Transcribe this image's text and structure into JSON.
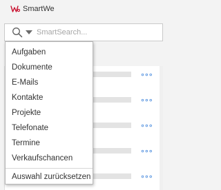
{
  "app": {
    "title": "SmartWe",
    "logo_text": "We",
    "brand_color": "#c8102e"
  },
  "search": {
    "placeholder": "SmartSearch...",
    "value": ""
  },
  "menu": {
    "items": [
      {
        "label": "Aufgaben"
      },
      {
        "label": "Dokumente"
      },
      {
        "label": "E-Mails"
      },
      {
        "label": "Kontakte"
      },
      {
        "label": "Projekte"
      },
      {
        "label": "Telefonate"
      },
      {
        "label": "Termine"
      },
      {
        "label": "Verkaufschancen"
      }
    ],
    "reset_label": "Auswahl zurücksetzen"
  },
  "results": {
    "more_icon": "ellipsis-icon"
  },
  "colors": {
    "accent": "#2b78d8",
    "border": "#c9c9c9"
  }
}
